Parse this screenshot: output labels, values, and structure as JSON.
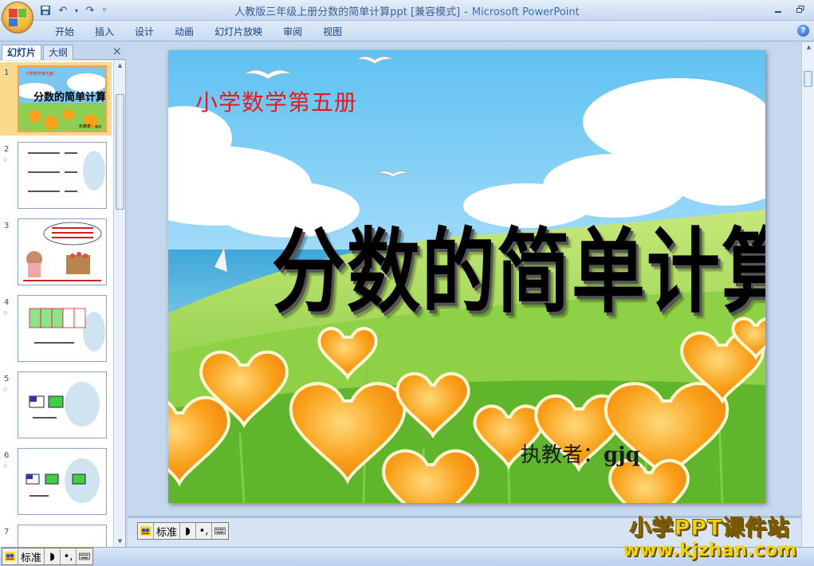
{
  "window": {
    "title": "人教版三年级上册分数的简单计算ppt [兼容模式]",
    "separator": "-",
    "app_name": "Microsoft PowerPoint",
    "minimize_icon": "minimize-icon",
    "restore_icon": "restore-icon"
  },
  "quick_access": {
    "save_icon": "save-icon",
    "undo_icon": "undo-icon",
    "redo_icon": "redo-icon",
    "customize_icon": "dropdown-icon"
  },
  "ribbon": {
    "tabs": [
      "开始",
      "插入",
      "设计",
      "动画",
      "幻灯片放映",
      "审阅",
      "视图"
    ],
    "help_label": "?"
  },
  "left_pane": {
    "tab_slides": "幻灯片",
    "tab_outline": "大纲",
    "close_label": "×",
    "thumbnails": [
      {
        "number": "1",
        "selected": true
      },
      {
        "number": "2",
        "selected": false
      },
      {
        "number": "3",
        "selected": false
      },
      {
        "number": "4",
        "selected": false
      },
      {
        "number": "5",
        "selected": false
      },
      {
        "number": "6",
        "selected": false
      },
      {
        "number": "7",
        "selected": false
      }
    ],
    "anim_marker": "☆"
  },
  "slide": {
    "subtitle": "小学数学第五册",
    "title": "分数的简单计算",
    "author_label": "执教者：",
    "author_name": "gjq"
  },
  "ime": {
    "mode_label": "标准"
  },
  "watermark": {
    "line1": "小学PPT课件站",
    "line2": "www.kjzhan.com"
  },
  "colors": {
    "subtitle": "#e8191e",
    "watermark": "#f4d400",
    "selection": "#f0a44a"
  }
}
